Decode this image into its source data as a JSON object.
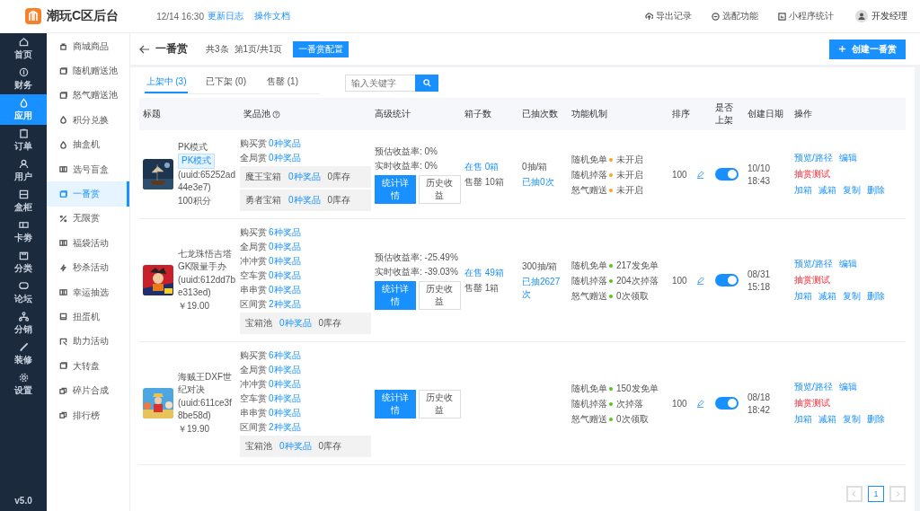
{
  "header": {
    "title": "潮玩C区后台",
    "time": "12/14 16:30",
    "links": [
      "更新日志",
      "操作文档"
    ],
    "actions": [
      "导出记录",
      "选配功能",
      "小程序统计"
    ],
    "user": "开发经理"
  },
  "rail": {
    "items": [
      {
        "label": "首页",
        "selected": false
      },
      {
        "label": "财务",
        "selected": false
      },
      {
        "label": "应用",
        "selected": true
      },
      {
        "label": "订单",
        "selected": false
      },
      {
        "label": "用户",
        "selected": false
      },
      {
        "label": "盒柜",
        "selected": false
      },
      {
        "label": "卡劵",
        "selected": false
      },
      {
        "label": "分类",
        "selected": false
      },
      {
        "label": "论坛",
        "selected": false
      },
      {
        "label": "分销",
        "selected": false
      },
      {
        "label": "装修",
        "selected": false
      },
      {
        "label": "设置",
        "selected": false
      }
    ],
    "version": "v5.0"
  },
  "sidebar": {
    "items": [
      {
        "label": "商城商品",
        "selected": false
      },
      {
        "label": "随机赠送池",
        "selected": false
      },
      {
        "label": "怒气赠送池",
        "selected": false
      },
      {
        "label": "积分兑换",
        "selected": false
      },
      {
        "label": "抽盒机",
        "selected": false
      },
      {
        "label": "选号盲盒",
        "selected": false
      },
      {
        "label": "一番赏",
        "selected": true
      },
      {
        "label": "无限赏",
        "selected": false
      },
      {
        "label": "福袋活动",
        "selected": false
      },
      {
        "label": "秒杀活动",
        "selected": false
      },
      {
        "label": "幸运抽选",
        "selected": false
      },
      {
        "label": "扭蛋机",
        "selected": false
      },
      {
        "label": "助力活动",
        "selected": false
      },
      {
        "label": "大转盘",
        "selected": false
      },
      {
        "label": "碎片合成",
        "selected": false
      },
      {
        "label": "排行榜",
        "selected": false
      }
    ]
  },
  "page": {
    "title": "一番赏",
    "count": "共3条",
    "pages": "第1页/共1页",
    "config_button": "一番赏配置",
    "create_button": "创建一番赏"
  },
  "tabs": [
    {
      "label": "上架中 (3)",
      "selected": true
    },
    {
      "label": "已下架 (0)",
      "selected": false
    },
    {
      "label": "售罄 (1)",
      "selected": false
    }
  ],
  "search": {
    "placeholder": "输入关键字"
  },
  "table": {
    "columns": [
      {
        "label": "标题",
        "kind": "plain"
      },
      {
        "label": "奖品池",
        "kind": "help"
      },
      {
        "label": "高级统计",
        "kind": "plain"
      },
      {
        "label": "箱子数",
        "kind": "plain"
      },
      {
        "label": "已抽次数",
        "kind": "plain"
      },
      {
        "label": "功能机制",
        "kind": "plain"
      },
      {
        "label": "排序",
        "kind": "plain"
      },
      {
        "label": "是否上架",
        "kind": "plain"
      },
      {
        "label": "创建日期",
        "kind": "plain"
      },
      {
        "label": "操作",
        "kind": "plain"
      }
    ],
    "rows": [
      {
        "title": "PK模式",
        "tag": "PK模式",
        "uuid": "(uuid:65252ad44e3e7)",
        "price": "100积分",
        "prizes": [
          {
            "kind": "line",
            "label": "购买赏",
            "value": "0种奖品"
          },
          {
            "kind": "line",
            "label": "全局赏",
            "value": "0种奖品"
          },
          {
            "kind": "box",
            "label": "魔王宝箱",
            "value": "0种奖品",
            "stock": "0库存"
          },
          {
            "kind": "box",
            "label": "勇者宝箱",
            "value": "0种奖品",
            "stock": "0库存"
          }
        ],
        "stats": {
          "lines": [
            "预估收益率: 0%",
            "实时收益率: 0%"
          ],
          "buttons": [
            "统计详情",
            "历史收益"
          ]
        },
        "boxes": {
          "on_sale": "在售 0箱",
          "sold_out": "售罄 10箱"
        },
        "draws": {
          "per_box": "0抽/箱",
          "drawn": "已抽0次"
        },
        "mechanisms": [
          {
            "label": "随机免单",
            "color": "#f5a623",
            "value": "未开启"
          },
          {
            "label": "随机掉落",
            "color": "#f5a623",
            "value": "未开启"
          },
          {
            "label": "怒气赠送",
            "color": "#f5a623",
            "value": "未开启"
          }
        ],
        "sort": "100",
        "on_sale": true,
        "date": "10/10",
        "time": "18:43",
        "ops": [
          {
            "label": "预览/路径",
            "kind": "link"
          },
          {
            "label": "编辑",
            "kind": "link"
          },
          {
            "label": "抽赏测试",
            "kind": "danger"
          },
          {
            "label": "加箱",
            "kind": "link"
          },
          {
            "label": "减箱",
            "kind": "link"
          },
          {
            "label": "复制",
            "kind": "link"
          },
          {
            "label": "删除",
            "kind": "link"
          }
        ]
      },
      {
        "title": "七龙珠悟吉塔GK限量手办",
        "uuid": "(uuid:612dd7be313ed)",
        "price": "￥19.00",
        "prizes": [
          {
            "kind": "line",
            "label": "购买赏",
            "value": "6种奖品"
          },
          {
            "kind": "line",
            "label": "全局赏",
            "value": "0种奖品"
          },
          {
            "kind": "line",
            "label": "冲冲赏",
            "value": "0种奖品"
          },
          {
            "kind": "line",
            "label": "空车赏",
            "value": "0种奖品"
          },
          {
            "kind": "line",
            "label": "串串赏",
            "value": "0种奖品"
          },
          {
            "kind": "line",
            "label": "区间赏",
            "value": "2种奖品"
          },
          {
            "kind": "box",
            "label": "宝箱池",
            "value": "0种奖品",
            "stock": "0库存"
          }
        ],
        "stats": {
          "lines": [
            "预估收益率: -25.49%",
            "实时收益率: -39.03%"
          ],
          "buttons": [
            "统计详情",
            "历史收益"
          ]
        },
        "boxes": {
          "on_sale": "在售 49箱",
          "sold_out": "售罄 1箱"
        },
        "draws": {
          "per_box": "300抽/箱",
          "drawn": "已抽2627次"
        },
        "mechanisms": [
          {
            "label": "随机免单",
            "color": "#52c41a",
            "value": "217发免单"
          },
          {
            "label": "随机掉落",
            "color": "#52c41a",
            "value": "204次掉落"
          },
          {
            "label": "怒气赠送",
            "color": "#52c41a",
            "value": "0次领取"
          }
        ],
        "sort": "100",
        "on_sale": true,
        "date": "08/31",
        "time": "15:18",
        "ops": [
          {
            "label": "预览/路径",
            "kind": "link"
          },
          {
            "label": "编辑",
            "kind": "link"
          },
          {
            "label": "抽赏测试",
            "kind": "danger"
          },
          {
            "label": "加箱",
            "kind": "link"
          },
          {
            "label": "减箱",
            "kind": "link"
          },
          {
            "label": "复制",
            "kind": "link"
          },
          {
            "label": "删除",
            "kind": "link"
          }
        ]
      },
      {
        "title": "海贼王DXF世纪对决",
        "uuid": "(uuid:611ce3f8be58d)",
        "price": "￥19.90",
        "prizes": [
          {
            "kind": "line",
            "label": "购买赏",
            "value": "6种奖品"
          },
          {
            "kind": "line",
            "label": "全局赏",
            "value": "0种奖品"
          },
          {
            "kind": "line",
            "label": "冲冲赏",
            "value": "0种奖品"
          },
          {
            "kind": "line",
            "label": "空车赏",
            "value": "0种奖品"
          },
          {
            "kind": "line",
            "label": "串串赏",
            "value": "0种奖品"
          },
          {
            "kind": "line",
            "label": "区间赏",
            "value": "2种奖品"
          },
          {
            "kind": "box",
            "label": "宝箱池",
            "value": "0种奖品",
            "stock": "0库存"
          }
        ],
        "stats": {
          "buttons": [
            "统计详情",
            "历史收益"
          ]
        },
        "mechanisms": [
          {
            "label": "随机免单",
            "color": "#52c41a",
            "value": "150发免单"
          },
          {
            "label": "随机掉落",
            "color": "#52c41a",
            "value": "次掉落"
          },
          {
            "label": "怒气赠送",
            "color": "#52c41a",
            "value": "0次领取"
          }
        ],
        "sort": "100",
        "on_sale": true,
        "date": "08/18",
        "time": "18:42",
        "ops": [
          {
            "label": "预览/路径",
            "kind": "link"
          },
          {
            "label": "编辑",
            "kind": "link"
          },
          {
            "label": "抽赏测试",
            "kind": "danger"
          },
          {
            "label": "加箱",
            "kind": "link"
          },
          {
            "label": "减箱",
            "kind": "link"
          },
          {
            "label": "复制",
            "kind": "link"
          },
          {
            "label": "删除",
            "kind": "link"
          }
        ]
      }
    ]
  },
  "pagination": {
    "pages": [
      {
        "label": "1",
        "selected": true
      }
    ]
  }
}
